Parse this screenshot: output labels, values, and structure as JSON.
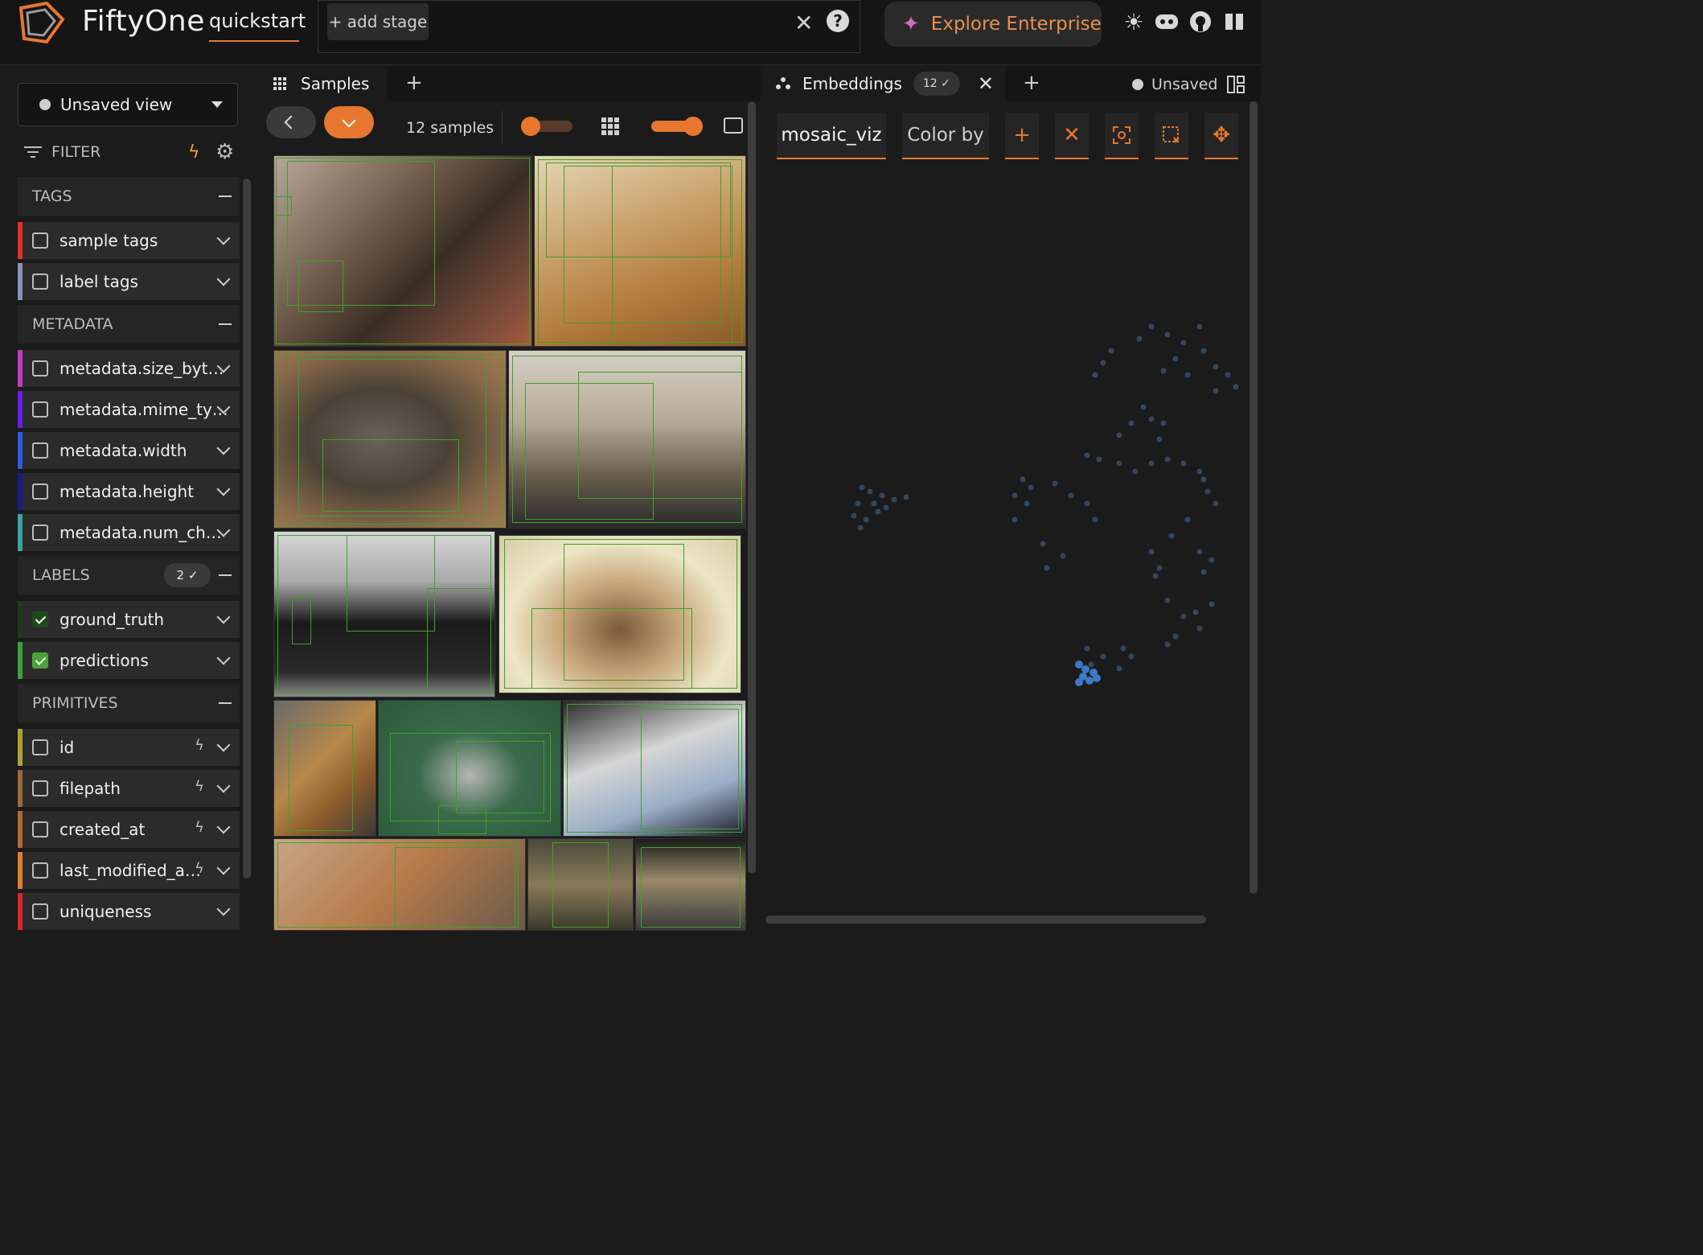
{
  "header": {
    "app_title": "FiftyOne",
    "dataset_name": "quickstart",
    "add_stage_label": "+ add stage",
    "enterprise_label": "Explore Enterprise",
    "icons": [
      "logo-icon",
      "close-icon",
      "help-icon",
      "sparkle-icon",
      "sun-icon",
      "discord-icon",
      "github-icon",
      "book-icon"
    ]
  },
  "sidebar": {
    "view_label": "Unsaved view",
    "filter_label": "FILTER",
    "sections": {
      "tags": "TAGS",
      "metadata": "METADATA",
      "labels": "LABELS",
      "labels_badge": "2",
      "primitives": "PRIMITIVES"
    },
    "items": [
      {
        "label": "sample tags",
        "color": "#e0312a",
        "checked": false
      },
      {
        "label": "label tags",
        "color": "#8e8ec0",
        "checked": false
      },
      {
        "label": "metadata.size_byt…",
        "color": "#c43ac6",
        "checked": false
      },
      {
        "label": "metadata.mime_ty…",
        "color": "#6a1ee6",
        "checked": false
      },
      {
        "label": "metadata.width",
        "color": "#2f5ae0",
        "checked": false
      },
      {
        "label": "metadata.height",
        "color": "#1a1a8e",
        "checked": false
      },
      {
        "label": "metadata.num_ch…",
        "color": "#3aa4a4",
        "checked": false
      },
      {
        "label": "ground_truth",
        "color": "#1d3a1a",
        "checked": true
      },
      {
        "label": "predictions",
        "color": "#3aa13a",
        "checked": true
      },
      {
        "label": "id",
        "color": "#b0a030",
        "checked": false
      },
      {
        "label": "filepath",
        "color": "#9a6a3a",
        "checked": false
      },
      {
        "label": "created_at",
        "color": "#b06a3a",
        "checked": false
      },
      {
        "label": "last_modified_a…",
        "color": "#e0802a",
        "checked": false
      },
      {
        "label": "uniqueness",
        "color": "#d42a2a",
        "checked": false
      }
    ]
  },
  "samples": {
    "tab_label": "Samples",
    "add_tab": "+",
    "count_label": "12 samples"
  },
  "embeddings": {
    "tab_label": "Embeddings",
    "count_badge": "12",
    "add_tab": "+",
    "status": "Unsaved",
    "brain_key": "mosaic_viz",
    "color_by": "Color by"
  }
}
